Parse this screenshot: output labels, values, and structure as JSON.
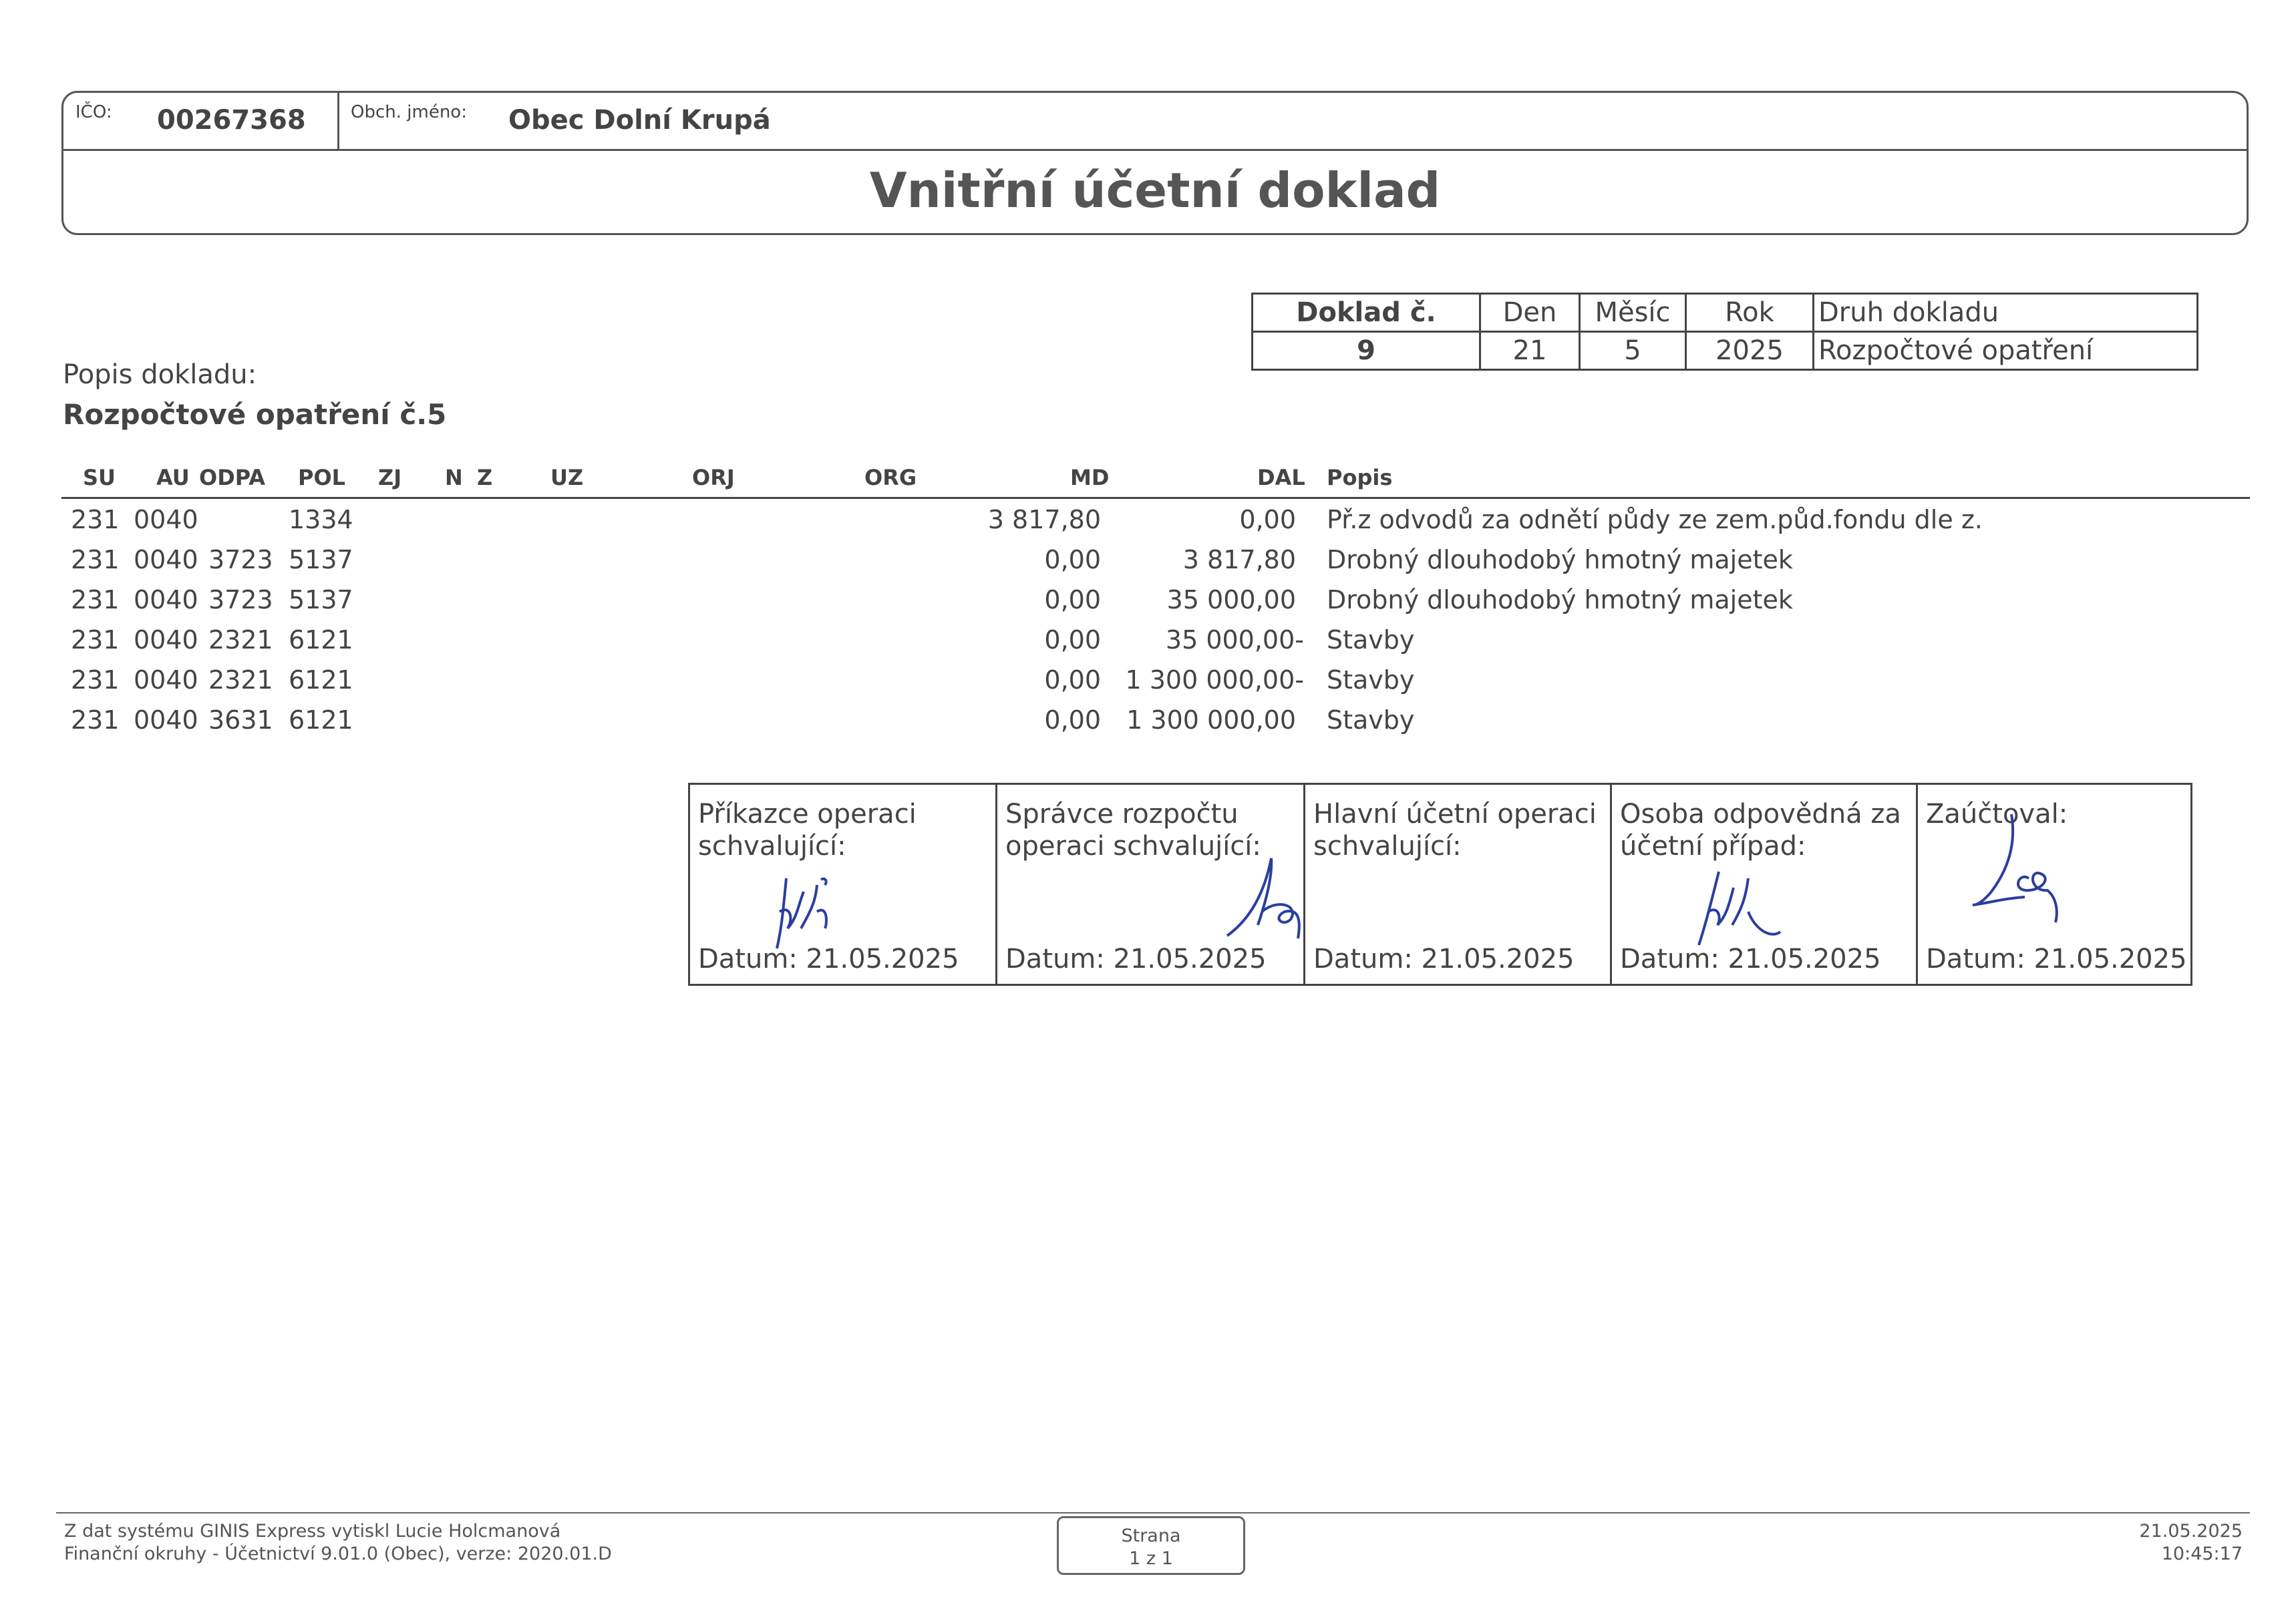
{
  "header": {
    "ico_label": "IČO:",
    "ico_value": "00267368",
    "name_label": "Obch. jméno:",
    "name_value": "Obec Dolní Krupá",
    "title": "Vnitřní účetní doklad"
  },
  "doklad": {
    "headers": [
      "Doklad č.",
      "Den",
      "Měsíc",
      "Rok",
      "Druh dokladu"
    ],
    "values": [
      "9",
      "21",
      "5",
      "2025",
      "Rozpočtové opatření"
    ]
  },
  "popis": {
    "label": "Popis dokladu:",
    "value": "Rozpočtové opatření č.5"
  },
  "table": {
    "columns": [
      "SU",
      "AU",
      "ODPA",
      "POL",
      "ZJ",
      "N",
      "Z",
      "UZ",
      "ORJ",
      "ORG",
      "MD",
      "DAL",
      "Popis"
    ],
    "rows": [
      {
        "su": "231",
        "au": "0040",
        "odpa": "",
        "pol": "1334",
        "md": "3 817,80",
        "dal": "0,00",
        "popis": "Př.z odvodů za odnětí půdy ze zem.půd.fondu dle z."
      },
      {
        "su": "231",
        "au": "0040",
        "odpa": "3723",
        "pol": "5137",
        "md": "0,00",
        "dal": "3 817,80",
        "popis": "Drobný dlouhodobý hmotný majetek"
      },
      {
        "su": "231",
        "au": "0040",
        "odpa": "3723",
        "pol": "5137",
        "md": "0,00",
        "dal": "35 000,00",
        "popis": "Drobný dlouhodobý hmotný majetek"
      },
      {
        "su": "231",
        "au": "0040",
        "odpa": "2321",
        "pol": "6121",
        "md": "0,00",
        "dal": "35 000,00-",
        "popis": "Stavby"
      },
      {
        "su": "231",
        "au": "0040",
        "odpa": "2321",
        "pol": "6121",
        "md": "0,00",
        "dal": "1 300 000,00-",
        "popis": "Stavby"
      },
      {
        "su": "231",
        "au": "0040",
        "odpa": "3631",
        "pol": "6121",
        "md": "0,00",
        "dal": "1 300 000,00",
        "popis": "Stavby"
      }
    ]
  },
  "signatures": [
    {
      "caption_1": "Příkazce operaci",
      "caption_2": "schvalující:",
      "date": "Datum: 21.05.2025"
    },
    {
      "caption_1": "Správce rozpočtu",
      "caption_2": "operaci schvalující:",
      "date": "Datum: 21.05.2025"
    },
    {
      "caption_1": "Hlavní účetní operaci",
      "caption_2": "schvalující:",
      "date": "Datum: 21.05.2025"
    },
    {
      "caption_1": "Osoba odpovědná za",
      "caption_2": "účetní případ:",
      "date": "Datum: 21.05.2025"
    },
    {
      "caption_1": "Zaúčtoval:",
      "caption_2": "",
      "date": "Datum: 21.05.2025"
    }
  ],
  "footer": {
    "line1": "Z dat systému GINIS Express vytiskl Lucie Holcmanová",
    "line2": "Finanční okruhy - Účetnictví 9.01.0 (Obec), verze: 2020.01.D",
    "strana_label": "Strana",
    "strana_value": "1 z 1",
    "date": "21.05.2025",
    "time": "10:45:17"
  }
}
